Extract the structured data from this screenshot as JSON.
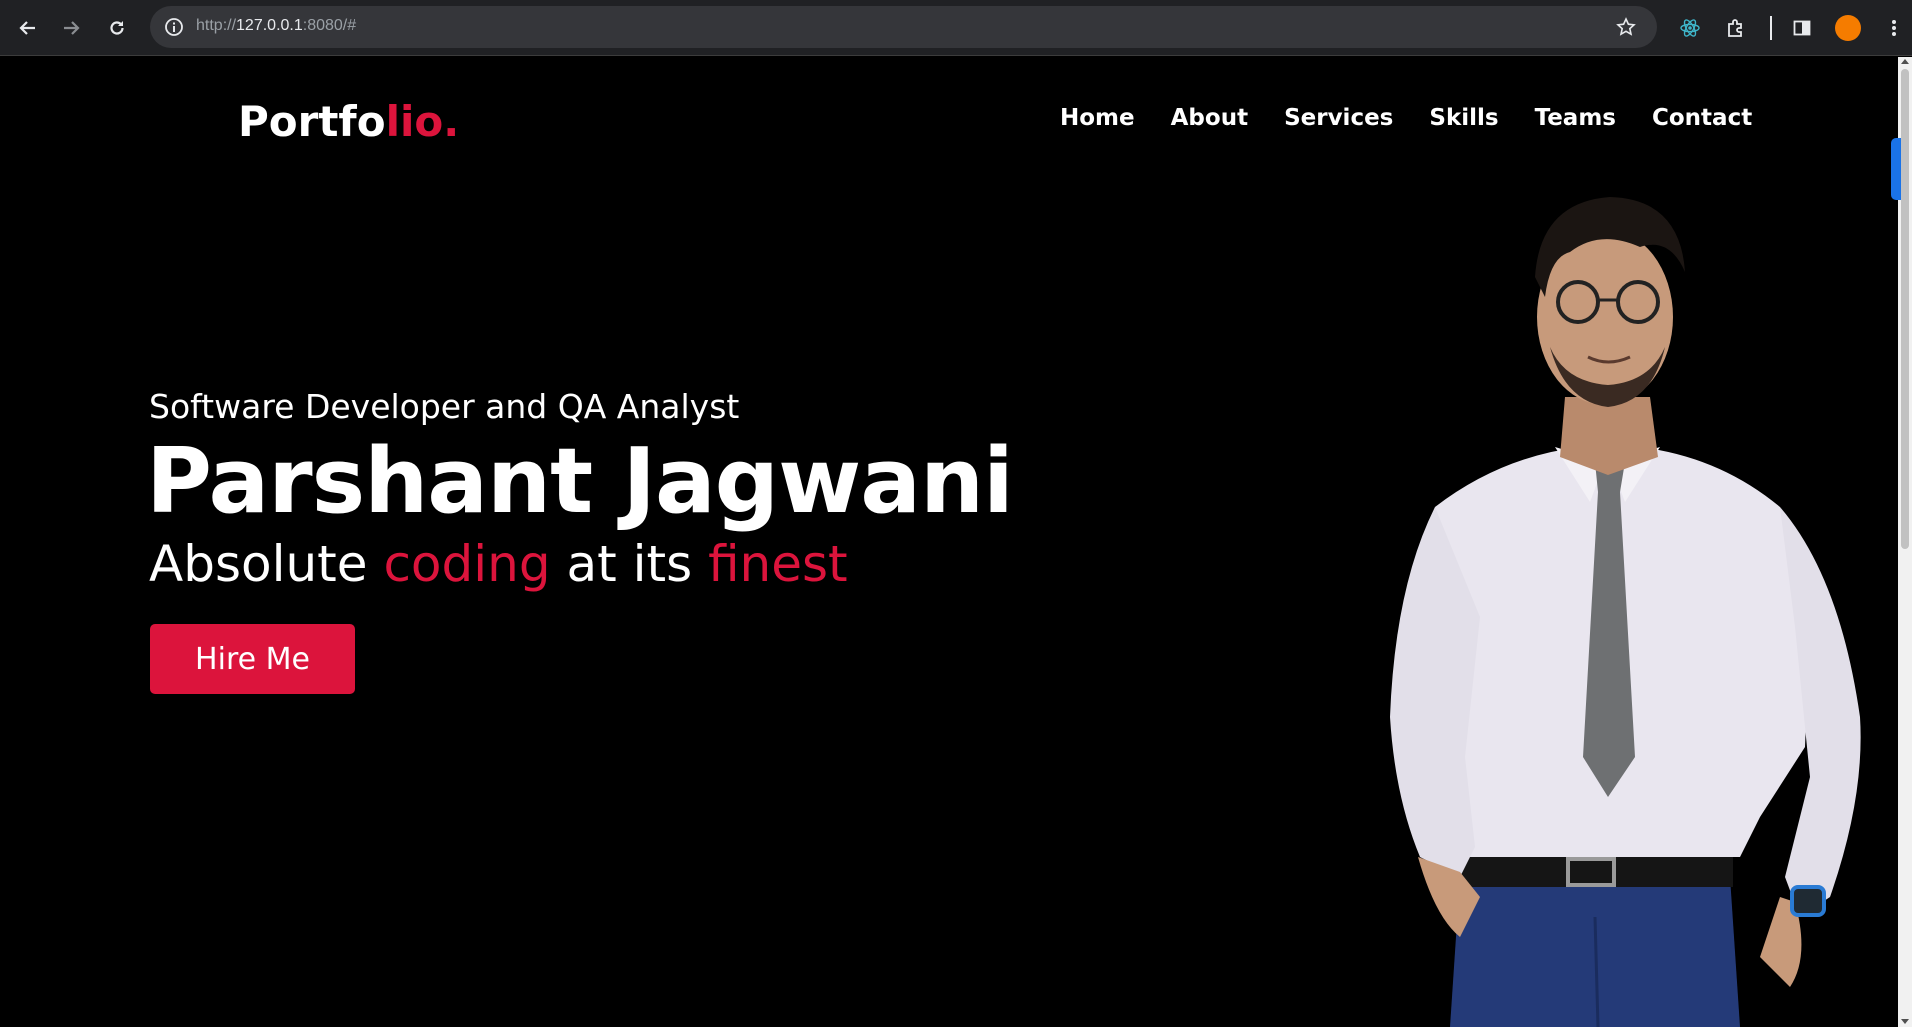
{
  "browser": {
    "url_scheme": "http://",
    "url_host": "127.0.0.1",
    "url_rest": ":8080/#"
  },
  "header": {
    "logo_main": "Portfo",
    "logo_accent": "lio.",
    "nav": [
      "Home",
      "About",
      "Services",
      "Skills",
      "Teams",
      "Contact"
    ]
  },
  "hero": {
    "subtitle": "Software Developer and QA Analyst",
    "name": "Parshant Jagwani",
    "tagline_1": "Absolute ",
    "tagline_2": "coding",
    "tagline_3": " at its ",
    "tagline_4": "finest",
    "cta_label": "Hire Me"
  },
  "colors": {
    "accent": "#dc143c",
    "background": "#000000",
    "chrome": "#202124",
    "profile": "#f57c00"
  }
}
